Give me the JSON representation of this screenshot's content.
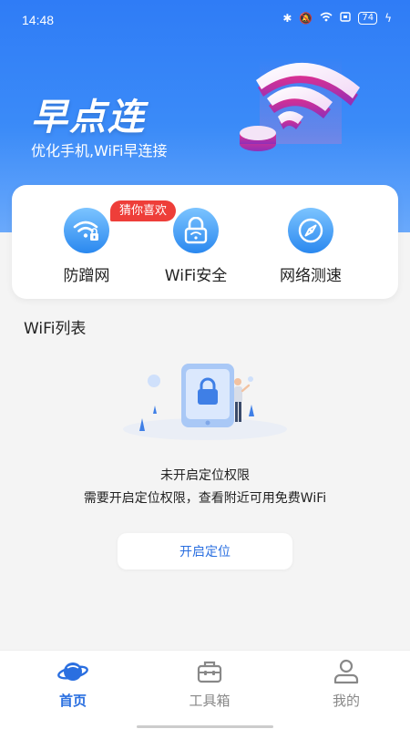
{
  "status_bar": {
    "time": "14:48",
    "battery": "74",
    "icons": [
      "bluetooth-icon",
      "mute-icon",
      "wifi-icon",
      "screen-icon",
      "battery-icon",
      "charging-icon"
    ]
  },
  "hero": {
    "title": "早点连",
    "subtitle": "优化手机,WiFi早连接"
  },
  "quick_actions": {
    "badge": "猜你喜欢",
    "items": [
      {
        "label": "防蹭网",
        "icon": "wifi-lock-icon"
      },
      {
        "label": "WiFi安全",
        "icon": "padlock-icon"
      },
      {
        "label": "网络测速",
        "icon": "compass-icon"
      }
    ]
  },
  "wifi_list": {
    "title": "WiFi列表",
    "empty_title": "未开启定位权限",
    "empty_desc": "需要开启定位权限，查看附近可用免费WiFi",
    "button": "开启定位"
  },
  "bottom_nav": {
    "items": [
      {
        "label": "首页",
        "icon": "planet-icon",
        "active": true
      },
      {
        "label": "工具箱",
        "icon": "toolbox-icon",
        "active": false
      },
      {
        "label": "我的",
        "icon": "person-icon",
        "active": false
      }
    ]
  },
  "colors": {
    "primary": "#2f7cf6",
    "badge": "#ee3e39",
    "link": "#2a6fe0"
  }
}
